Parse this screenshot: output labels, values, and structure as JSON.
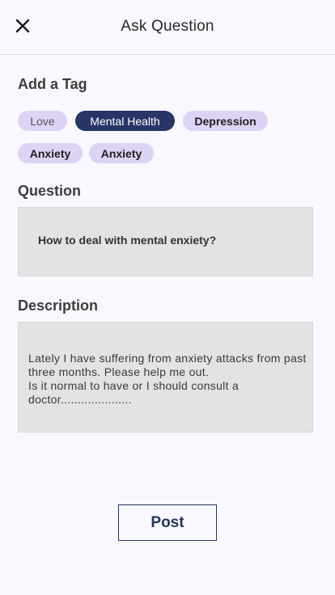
{
  "header": {
    "title": "Ask Question",
    "close_icon": "close-icon"
  },
  "tags_section": {
    "label": "Add a Tag",
    "tags": [
      {
        "label": "Love",
        "selected": false
      },
      {
        "label": "Mental Health",
        "selected": true
      },
      {
        "label": "Depression",
        "selected": false
      },
      {
        "label": "Anxiety",
        "selected": false
      },
      {
        "label": "Anxiety",
        "selected": false
      }
    ]
  },
  "question": {
    "label": "Question",
    "value": "How to deal with mental enxiety?"
  },
  "description": {
    "label": "Description",
    "value": "Lately I have suffering from anxiety attacks from past three months. Please help me out.\nIs it normal to have or I should consult a doctor....................."
  },
  "actions": {
    "post_label": "Post"
  },
  "colors": {
    "background": "#f8f8fe",
    "tag_bg": "#ddd3f5",
    "tag_selected_bg": "#273567",
    "box_bg": "#e3e3e3",
    "accent": "#273567"
  }
}
